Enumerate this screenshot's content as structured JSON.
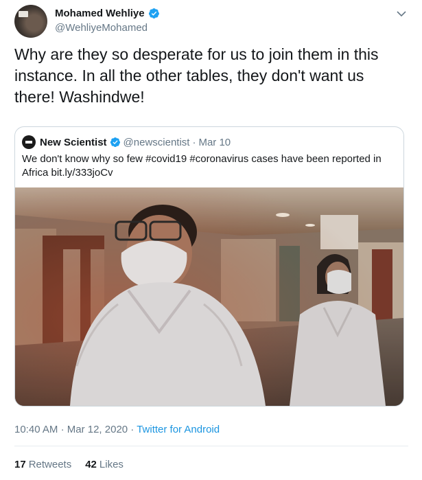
{
  "author": {
    "name": "Mohamed Wehliye",
    "handle": "@WehliyeMohamed"
  },
  "tweet": {
    "text": "Why are they so desperate for us to join them in this instance. In all the other tables, they don't want us there! Washindwe!"
  },
  "quoted": {
    "name": "New Scientist",
    "handle": "@newscientist",
    "separator": "·",
    "date": "Mar 10",
    "text": "We don't know why so few #covid19 #coronavirus cases have been reported in Africa bit.ly/333joCv"
  },
  "meta": {
    "time": "10:40 AM",
    "separator": "·",
    "date": "Mar 12, 2020",
    "source": "Twitter for Android"
  },
  "stats": {
    "retweets_count": "17",
    "retweets_label": "Retweets",
    "likes_count": "42",
    "likes_label": "Likes"
  },
  "colors": {
    "link": "#1b95e0",
    "verified": "#1da1f2",
    "secondary_text": "#657786"
  },
  "icons": [
    "verified-badge-icon",
    "chevron-down-icon"
  ]
}
